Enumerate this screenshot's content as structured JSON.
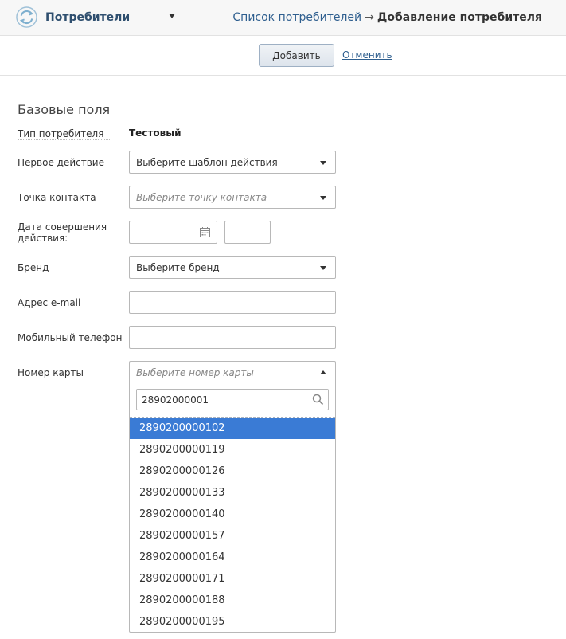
{
  "header": {
    "section_title": "Потребители",
    "breadcrumb": {
      "link": "Список потребителей",
      "arrow": "→",
      "current": "Добавление потребителя"
    }
  },
  "actions": {
    "add_label": "Добавить",
    "cancel_label": "Отменить"
  },
  "form": {
    "group_title": "Базовые поля",
    "consumer_type": {
      "label": "Тип потребителя",
      "value": "Тестовый"
    },
    "first_action": {
      "label": "Первое действие",
      "placeholder": "Выберите шаблон действия"
    },
    "contact_point": {
      "label": "Точка контакта",
      "placeholder": "Выберите точку контакта"
    },
    "action_date": {
      "label_line1": "Дата совершения",
      "label_line2": "действия:"
    },
    "brand": {
      "label": "Бренд",
      "placeholder": "Выберите бренд"
    },
    "email": {
      "label": "Адрес e-mail"
    },
    "phone": {
      "label": "Мобильный телефон"
    },
    "card_number": {
      "label": "Номер карты",
      "placeholder": "Выберите номер карты",
      "search_value": "28902000001",
      "options": [
        "2890200000102",
        "2890200000119",
        "2890200000126",
        "2890200000133",
        "2890200000140",
        "2890200000157",
        "2890200000164",
        "2890200000171",
        "2890200000188",
        "2890200000195"
      ],
      "selected_index": 0
    }
  },
  "icons": {
    "logo": "refresh-arrows-icon",
    "section_caret": "caret-down-icon",
    "calendar": "calendar-icon",
    "search": "search-icon"
  },
  "colors": {
    "brand": "#2f4f6f",
    "link": "#2f5f8f",
    "selected_option": "#3a7bd5"
  }
}
